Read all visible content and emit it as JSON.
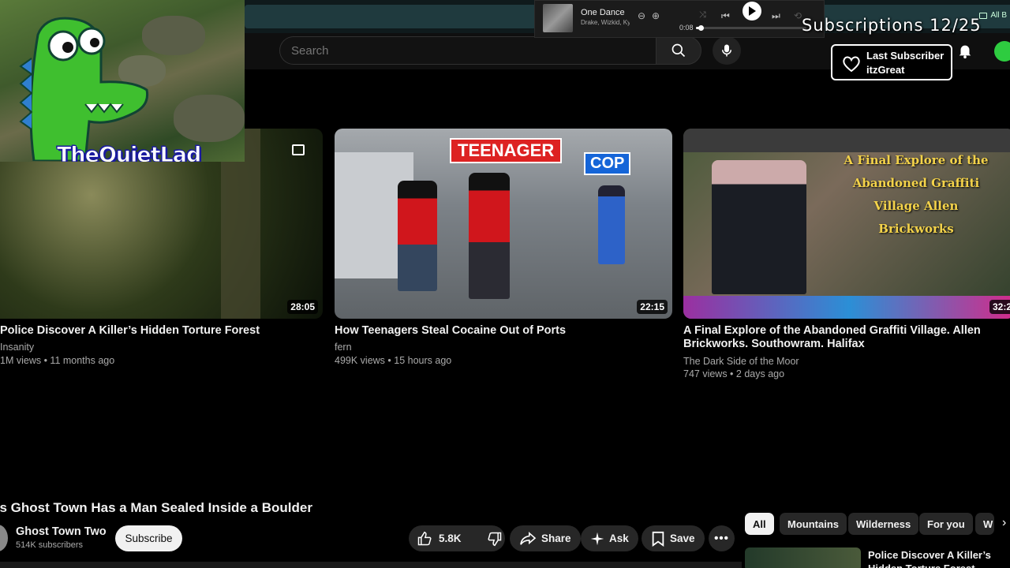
{
  "browser": {
    "bookmark_label": "All B"
  },
  "header": {
    "search_placeholder": "Search",
    "icons": [
      "search-icon",
      "mic-icon",
      "bell-icon"
    ]
  },
  "music": {
    "title": "One Dance",
    "artist": "Drake, Wizkid, Kyla",
    "elapsed": "0:08",
    "progress": 0.04
  },
  "overlay": {
    "subs_counter": "Subscriptions 12/25",
    "last_subscriber_label": "Last Subscriber",
    "last_subscriber_name": "itzGreat",
    "webcam_name": "TheQuietLad"
  },
  "videos": [
    {
      "title": "Police Discover A Killer’s Hidden Torture Forest",
      "channel": "Insanity",
      "meta": "1M views • 11 months ago",
      "duration": "28:05"
    },
    {
      "title": "How Teenagers Steal Cocaine Out of Ports",
      "channel": "fern",
      "meta": "499K views • 15 hours ago",
      "duration": "22:15",
      "labels": [
        "TEENAGER",
        "COP"
      ]
    },
    {
      "title": "A Final Explore of the Abandoned Graffiti Village. Allen Brickworks. Southowram. Halifax",
      "channel": "The Dark Side of the Moor",
      "meta": "747 views • 2 days ago",
      "duration": "32:2",
      "thumb_text": "A Final Explore of the Abandoned Graffiti Village Allen Brickworks"
    }
  ],
  "watch": {
    "title": "This Ghost Town Has a Man Sealed Inside a Boulder",
    "channel": "Ghost Town Two",
    "subscribers": "514K subscribers",
    "subscribe_label": "Subscribe",
    "likes": "5.8K",
    "share_label": "Share",
    "ask_label": "Ask",
    "save_label": "Save"
  },
  "chips": [
    "All",
    "Mountains",
    "Wilderness",
    "For you",
    "W"
  ],
  "side": {
    "title": "Police Discover A Killer’s Hidden Torture Forest"
  }
}
